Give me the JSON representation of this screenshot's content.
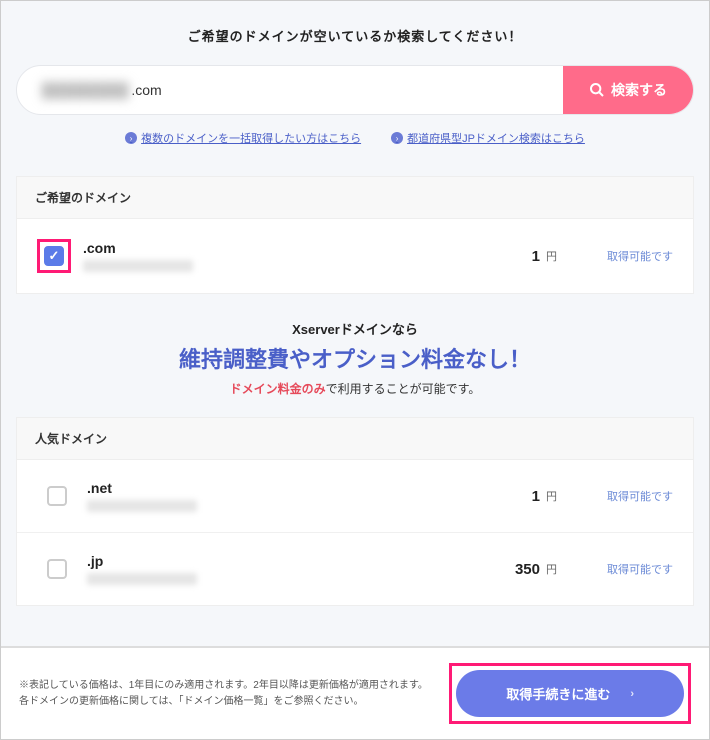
{
  "top": {
    "prompt": "ご希望のドメインが空いているか検索してください！",
    "input_suffix": ".com",
    "search_button": "検索する"
  },
  "links": {
    "bulk": "複数のドメインを一括取得したい方はこちら",
    "prefecture": "都道府県型JPドメイン検索はこちら"
  },
  "desired": {
    "header": "ご希望のドメイン",
    "items": [
      {
        "ext": ".com",
        "price": "1",
        "currency": "円",
        "status": "取得可能です",
        "checked": true
      }
    ]
  },
  "promo": {
    "line1_prefix": "Xserver",
    "line1_suffix": "ドメインなら",
    "line2": "維持調整費やオプション料金なし！",
    "line3_red": "ドメイン料金のみ",
    "line3_rest": "で利用することが可能です。"
  },
  "popular": {
    "header": "人気ドメイン",
    "items": [
      {
        "ext": ".net",
        "price": "1",
        "currency": "円",
        "status": "取得可能です",
        "checked": false
      },
      {
        "ext": ".jp",
        "price": "350",
        "currency": "円",
        "status": "取得可能です",
        "checked": false
      }
    ]
  },
  "footer": {
    "disclaimer1": "※表記している価格は、1年目にのみ適用されます。2年目以降は更新価格が適用されます。",
    "disclaimer2": "各ドメインの更新価格に関しては、「ドメイン価格一覧」をご参照ください。",
    "proceed": "取得手続きに進む"
  }
}
